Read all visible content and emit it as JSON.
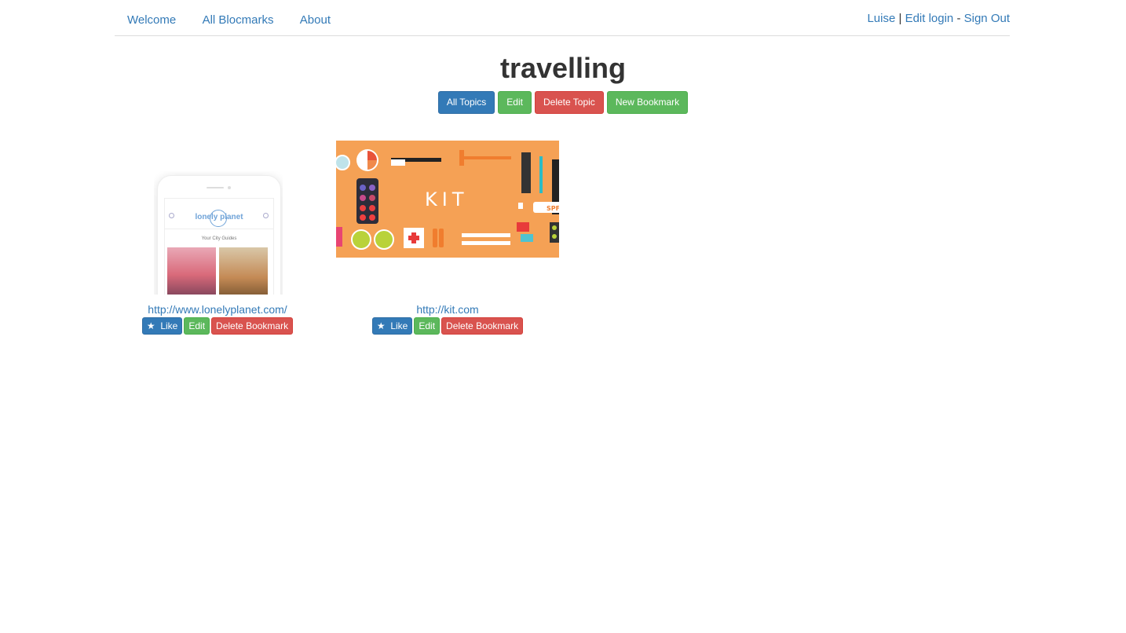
{
  "nav": {
    "links": [
      "Welcome",
      "All Blocmarks",
      "About"
    ],
    "user": "Luise",
    "separator1": "|",
    "edit_login": "Edit login",
    "separator2": "-",
    "sign_out": "Sign Out"
  },
  "topic": {
    "title": "travelling",
    "actions": {
      "all_topics": "All Topics",
      "edit": "Edit",
      "delete_topic": "Delete Topic",
      "new_bookmark": "New Bookmark"
    }
  },
  "bookmarks": [
    {
      "url": "http://www.lonelyplanet.com/",
      "thumb": {
        "logo_text": "lonely planet",
        "subtitle": "Your City Guides"
      },
      "like_icon": "★",
      "like": "Like",
      "edit": "Edit",
      "delete": "Delete Bookmark"
    },
    {
      "url": "http://kit.com",
      "thumb": {
        "logo_text": "KIT",
        "sticker_text": "SPF"
      },
      "like_icon": "★",
      "like": "Like",
      "edit": "Edit",
      "delete": "Delete Bookmark"
    }
  ],
  "colors": {
    "link": "#337ab7",
    "primary": "#337ab7",
    "success": "#5cb85c",
    "danger": "#d9534f",
    "kit_bg": "#f5a155"
  }
}
